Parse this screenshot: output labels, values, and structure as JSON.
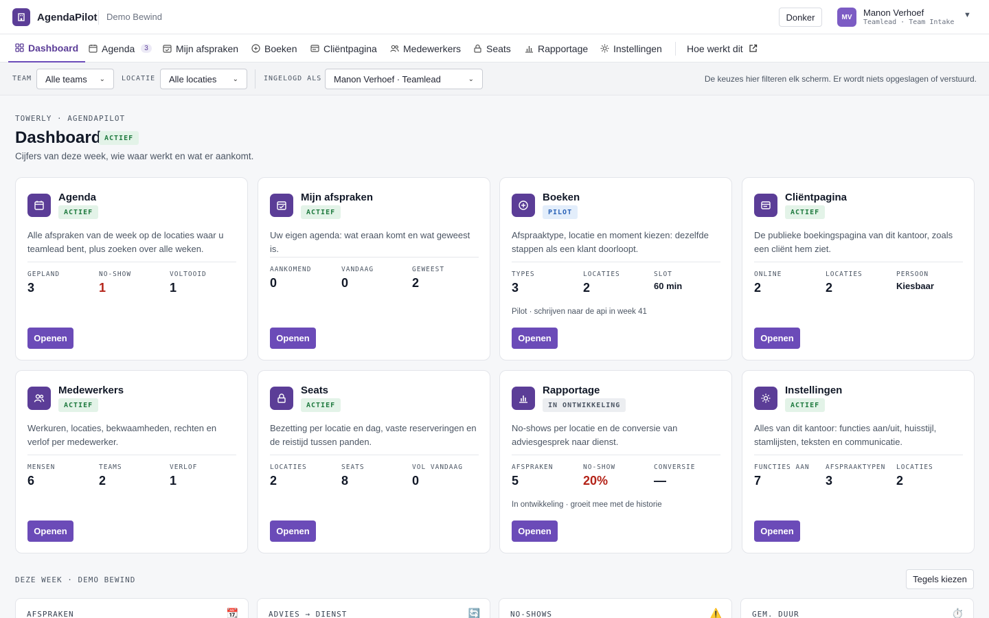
{
  "app": {
    "name": "AgendaPilot",
    "org": "Demo Bewind"
  },
  "topbar": {
    "theme_button": "Donker",
    "user": {
      "initials": "MV",
      "name": "Manon Verhoef",
      "role": "Teamlead · Team Intake"
    }
  },
  "nav": {
    "items": [
      {
        "label": "Dashboard",
        "icon": "grid-icon",
        "active": true
      },
      {
        "label": "Agenda",
        "icon": "calendar-icon",
        "badge": "3"
      },
      {
        "label": "Mijn afspraken",
        "icon": "calendar-check-icon"
      },
      {
        "label": "Boeken",
        "icon": "plus-circle-icon"
      },
      {
        "label": "Cliëntpagina",
        "icon": "window-icon"
      },
      {
        "label": "Medewerkers",
        "icon": "users-icon"
      },
      {
        "label": "Seats",
        "icon": "lock-icon"
      },
      {
        "label": "Rapportage",
        "icon": "bar-chart-icon"
      },
      {
        "label": "Instellingen",
        "icon": "sun-icon"
      }
    ],
    "help": {
      "label": "Hoe werkt dit",
      "icon": "external-link-icon"
    }
  },
  "filters": {
    "team": {
      "label": "TEAM",
      "value": "Alle teams"
    },
    "location": {
      "label": "LOCATIE",
      "value": "Alle locaties"
    },
    "logged_in_as": {
      "label": "INGELOGD ALS",
      "value": "Manon Verhoef · Teamlead"
    },
    "note": "De keuzes hier filteren elk scherm. Er wordt niets opgeslagen of verstuurd."
  },
  "header": {
    "eyebrow": "TOWERLY · AGENDAPILOT",
    "title": "Dashboard",
    "status": "ACTIEF",
    "subtitle": "Cijfers van deze week, wie waar werkt en wat er aankomt."
  },
  "cards": [
    {
      "title": "Agenda",
      "status": "ACTIEF",
      "description": "Alle afspraken van de week op de locaties waar u teamlead bent, plus zoeken over alle weken.",
      "stats": [
        {
          "label": "GEPLAND",
          "value": "3"
        },
        {
          "label": "NO-SHOW",
          "value": "1"
        },
        {
          "label": "VOLTOOID",
          "value": "1"
        }
      ],
      "note": "",
      "button": "Openen"
    },
    {
      "title": "Mijn afspraken",
      "status": "ACTIEF",
      "description": "Uw eigen agenda: wat eraan komt en wat geweest is.",
      "stats": [
        {
          "label": "AANKOMEND",
          "value": "0"
        },
        {
          "label": "VANDAAG",
          "value": "0"
        },
        {
          "label": "GEWEEST",
          "value": "2"
        }
      ],
      "note": "",
      "button": "Openen"
    },
    {
      "title": "Boeken",
      "status": "PILOT",
      "description": "Afspraaktype, locatie en moment kiezen: dezelfde stappen als een klant doorloopt.",
      "stats": [
        {
          "label": "TYPES",
          "value": "3"
        },
        {
          "label": "LOCATIES",
          "value": "2"
        },
        {
          "label": "SLOT",
          "value": "60 min"
        }
      ],
      "note": "Pilot · schrijven naar de api in week 41",
      "button": "Openen"
    },
    {
      "title": "Cliëntpagina",
      "status": "ACTIEF",
      "description": "De publieke boekingspagina van dit kantoor, zoals een cliënt hem ziet.",
      "stats": [
        {
          "label": "ONLINE",
          "value": "2"
        },
        {
          "label": "LOCATIES",
          "value": "2"
        },
        {
          "label": "PERSOON",
          "value": "Kiesbaar"
        }
      ],
      "note": "",
      "button": "Openen"
    },
    {
      "title": "Medewerkers",
      "status": "ACTIEF",
      "description": "Werkuren, locaties, bekwaamheden, rechten en verlof per medewerker.",
      "stats": [
        {
          "label": "MENSEN",
          "value": "6"
        },
        {
          "label": "TEAMS",
          "value": "2"
        },
        {
          "label": "VERLOF",
          "value": "1"
        }
      ],
      "note": "",
      "button": "Openen"
    },
    {
      "title": "Seats",
      "status": "ACTIEF",
      "description": "Bezetting per locatie en dag, vaste reserveringen en de reistijd tussen panden.",
      "stats": [
        {
          "label": "LOCATIES",
          "value": "2"
        },
        {
          "label": "SEATS",
          "value": "8"
        },
        {
          "label": "VOL VANDAAG",
          "value": "0"
        }
      ],
      "note": "",
      "button": "Openen"
    },
    {
      "title": "Rapportage",
      "status": "IN ONTWIKKELING",
      "description": "No-shows per locatie en de conversie van adviesgesprek naar dienst.",
      "stats": [
        {
          "label": "AFSPRAKEN",
          "value": "5"
        },
        {
          "label": "NO-SHOW",
          "value": "20%"
        },
        {
          "label": "CONVERSIE",
          "value": "—"
        }
      ],
      "note": "In ontwikkeling · groeit mee met de historie",
      "button": "Openen"
    },
    {
      "title": "Instellingen",
      "status": "ACTIEF",
      "description": "Alles van dit kantoor: functies aan/uit, huisstijl, stamlijsten, teksten en communicatie.",
      "stats": [
        {
          "label": "FUNCTIES AAN",
          "value": "7"
        },
        {
          "label": "AFSPRAAKTYPEN",
          "value": "3"
        },
        {
          "label": "LOCATIES",
          "value": "2"
        }
      ],
      "note": "",
      "button": "Openen"
    }
  ],
  "week": {
    "eyebrow": "DEZE WEEK · DEMO BEWIND",
    "tiles_button": "Tegels kiezen",
    "kpis": [
      {
        "label": "AFSPRAKEN",
        "icon": "📆"
      },
      {
        "label": "ADVIES → DIENST",
        "icon": "🔄"
      },
      {
        "label": "NO-SHOWS",
        "icon": "⚠️"
      },
      {
        "label": "GEM. DUUR",
        "icon": "⏱️"
      }
    ]
  }
}
